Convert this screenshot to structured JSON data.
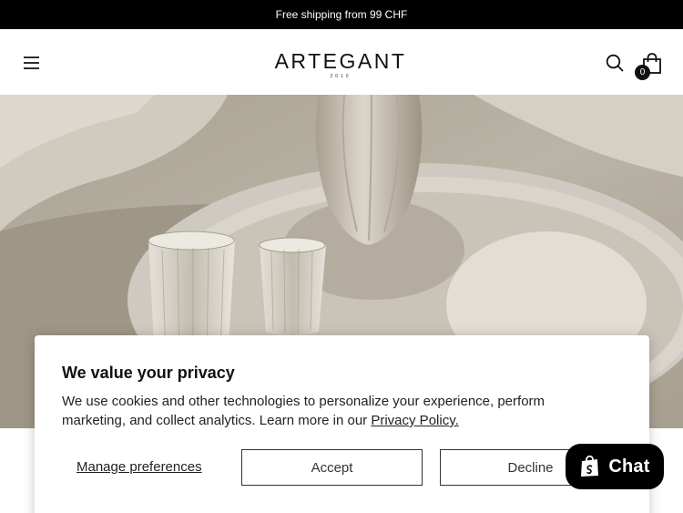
{
  "announcement": {
    "text": "Free shipping from 99 CHF"
  },
  "header": {
    "brand": "ARTEGANT",
    "brand_sub": "2010",
    "cart_count": "0",
    "icons": [
      "hamburger-menu-icon",
      "search-icon",
      "shopping-bag-icon"
    ]
  },
  "hero": {
    "image": "hero-photo"
  },
  "privacy": {
    "title": "We value your privacy",
    "body": "We use cookies and other technologies to personalize your experience, perform marketing, and collect analytics. Learn more in our ",
    "link": "Privacy Policy.",
    "manage": "Manage preferences",
    "accept": "Accept",
    "decline": "Decline"
  },
  "chat": {
    "label": "Chat",
    "icon": "shopify-bag-icon"
  },
  "colors": {
    "announcement_bg": "#000000",
    "chat_bg": "#000000",
    "text": "#111111"
  }
}
